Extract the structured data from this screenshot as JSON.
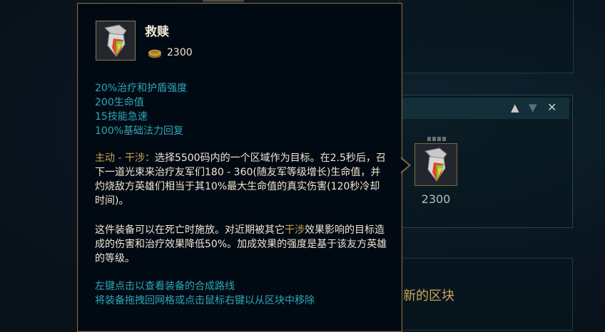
{
  "tooltip": {
    "item_name": "救赎",
    "price": "2300",
    "stats": [
      "20%治疗和护盾强度",
      "200生命值",
      "15技能急速",
      "100%基础法力回复"
    ],
    "active_prefix": "主动 - 干涉：",
    "active_text": "选择5500码内的一个区域作为目标。在2.5秒后，召下一道光束来治疗友军们180 - 360(随友军等级增长)生命值，并灼烧敌方英雄们相当于其10%最大生命值的真实伤害(120秒冷却时间)。",
    "passive_part1": "这件装备可以在死亡时施放。对近期被其它",
    "passive_highlight": "干涉",
    "passive_part2": "效果影响的目标造成的伤害和治疗效果降低50%。加成效果的强度是基于该友方英雄的等级。",
    "hint1": "左键点击以查看装备的合成路线",
    "hint2": "将装备拖拽回网格或点击鼠标右键以从区块中移除"
  },
  "block": {
    "up_icon": "▲",
    "down_icon": "▼",
    "close_icon": "✕",
    "item_price": "2300"
  },
  "bottom_panel": {
    "text": "新的区块"
  },
  "colors": {
    "gold_border": "#7c6a3e",
    "stat_blue": "#2ea7b8",
    "text_light": "#f0e6d2",
    "active_gold": "#c8a050"
  }
}
